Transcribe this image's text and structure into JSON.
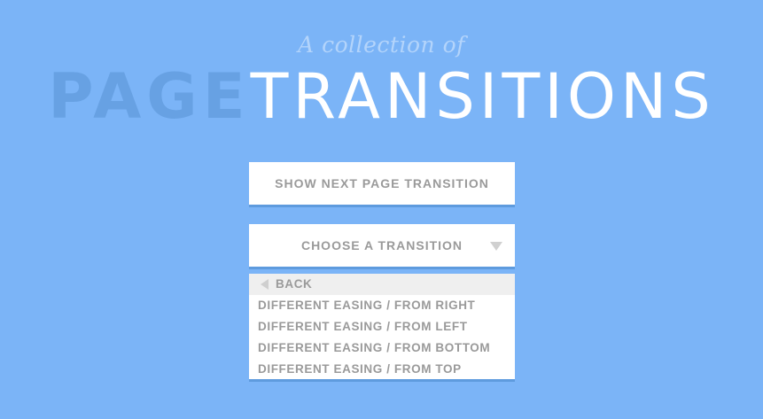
{
  "header": {
    "subtitle": "A collection of",
    "title_bold": "PAGE",
    "title_light": "TRANSITIONS"
  },
  "buttons": {
    "next_label": "SHOW NEXT PAGE TRANSITION",
    "choose_label": "CHOOSE A TRANSITION"
  },
  "dropdown": {
    "back_label": "BACK",
    "items": [
      "DIFFERENT EASING / FROM RIGHT",
      "DIFFERENT EASING / FROM LEFT",
      "DIFFERENT EASING / FROM BOTTOM",
      "DIFFERENT EASING / FROM TOP"
    ]
  },
  "colors": {
    "background": "#7bb4f7",
    "title_bold": "#67a1e3",
    "button_text": "#9a9a9a"
  }
}
